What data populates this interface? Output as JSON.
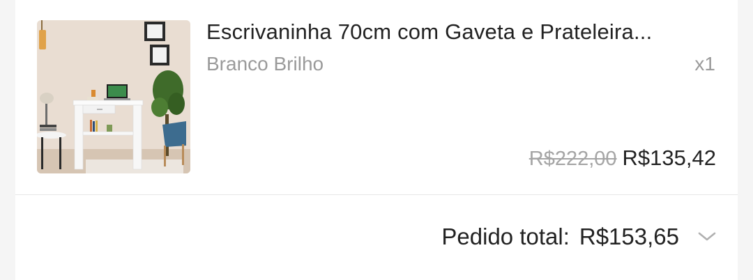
{
  "product": {
    "title": "Escrivaninha 70cm com Gaveta e Prateleira...",
    "variant": "Branco Brilho",
    "quantity": "x1",
    "original_price": "R$222,00",
    "price": "R$135,42",
    "image_icon": "product-thumbnail"
  },
  "order": {
    "total_label": "Pedido total:",
    "total_value": "R$153,65",
    "expand_icon": "chevron-down-icon"
  }
}
